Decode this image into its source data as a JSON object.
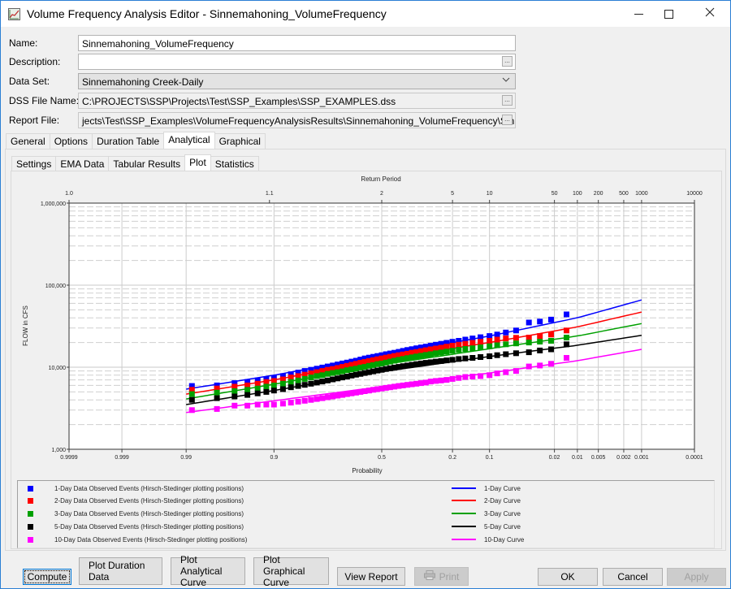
{
  "window": {
    "title": "Volume Frequency Analysis Editor - Sinnemahoning_VolumeFrequency",
    "minimize_icon": "minimize-icon",
    "maximize_icon": "maximize-icon",
    "close_icon": "close-icon"
  },
  "form": {
    "name_label": "Name:",
    "name_value": "Sinnemahoning_VolumeFrequency",
    "description_label": "Description:",
    "description_value": "",
    "dataset_label": "Data Set:",
    "dataset_value": "Sinnemahoning Creek-Daily",
    "dss_label": "DSS File Name:",
    "dss_value": "C:\\PROJECTS\\SSP\\Projects\\Test\\SSP_Examples\\SSP_EXAMPLES.dss",
    "report_label": "Report File:",
    "report_value": "jects\\Test\\SSP_Examples\\VolumeFrequencyAnalysisResults\\Sinnemahoning_VolumeFrequency\\Sinnemaho",
    "browse_label": "..."
  },
  "main_tabs": [
    {
      "label": "General",
      "active": false
    },
    {
      "label": "Options",
      "active": false
    },
    {
      "label": "Duration Table",
      "active": false
    },
    {
      "label": "Analytical",
      "active": true
    },
    {
      "label": "Graphical",
      "active": false
    }
  ],
  "sub_tabs": [
    {
      "label": "Settings",
      "active": false
    },
    {
      "label": "EMA Data",
      "active": false
    },
    {
      "label": "Tabular Results",
      "active": false
    },
    {
      "label": "Plot",
      "active": true
    },
    {
      "label": "Statistics",
      "active": false
    }
  ],
  "chart_data": {
    "type": "scatter",
    "title": "",
    "xlabel": "Probability",
    "ylabel": "FLOW in CFS",
    "x2label": "Return Period",
    "x_scale": "normal-probability",
    "y_scale": "log",
    "ylim": [
      1000,
      1000000
    ],
    "xlim": [
      0.9999,
      0.0001
    ],
    "grid": true,
    "x_ticks": [
      "0.9999",
      "0.999",
      "0.99",
      "0.9",
      "0.5",
      "0.2",
      "0.1",
      "0.02",
      "0.01",
      "0.005",
      "0.002",
      "0.001",
      "0.0001"
    ],
    "x_tick_values": [
      0.9999,
      0.999,
      0.99,
      0.9,
      0.5,
      0.2,
      0.1,
      0.02,
      0.01,
      0.005,
      0.002,
      0.001,
      0.0001
    ],
    "x2_ticks": [
      "1.0",
      "1.1",
      "2",
      "5",
      "10",
      "50",
      "100",
      "200",
      "500",
      "1000",
      "10000"
    ],
    "x2_tick_probs": [
      0.9999,
      0.9091,
      0.5,
      0.2,
      0.1,
      0.02,
      0.01,
      0.005,
      0.002,
      0.001,
      0.0001
    ],
    "y_ticks": [
      "1,000",
      "10,000",
      "100,000",
      "1,000,000"
    ],
    "y_tick_values": [
      1000,
      10000,
      100000,
      1000000
    ],
    "legend_position": "bottom",
    "series": [
      {
        "name": "1-Day Data Observed Events (Hirsch-Stedinger plotting positions)",
        "kind": "points",
        "color": "#0000ff",
        "x": [
          0.988,
          0.975,
          0.96,
          0.945,
          0.93,
          0.915,
          0.9,
          0.88,
          0.86,
          0.84,
          0.82,
          0.8,
          0.78,
          0.76,
          0.74,
          0.72,
          0.7,
          0.68,
          0.66,
          0.64,
          0.62,
          0.6,
          0.58,
          0.56,
          0.54,
          0.52,
          0.5,
          0.48,
          0.46,
          0.44,
          0.42,
          0.4,
          0.38,
          0.36,
          0.34,
          0.32,
          0.3,
          0.28,
          0.26,
          0.24,
          0.22,
          0.2,
          0.18,
          0.16,
          0.14,
          0.12,
          0.1,
          0.085,
          0.07,
          0.055,
          0.04,
          0.03,
          0.022,
          0.014
        ],
        "y": [
          5900,
          6000,
          6400,
          6600,
          6900,
          7100,
          7400,
          7800,
          8200,
          8600,
          9000,
          9300,
          9600,
          9900,
          10200,
          10500,
          10800,
          11100,
          11400,
          11700,
          12000,
          12400,
          12800,
          13100,
          13400,
          13700,
          14000,
          14400,
          14700,
          15000,
          15400,
          15800,
          16200,
          16600,
          17000,
          17400,
          17800,
          18300,
          18800,
          19300,
          19800,
          20400,
          21000,
          21700,
          22400,
          23200,
          24000,
          25000,
          26500,
          28000,
          35000,
          36000,
          38000,
          44000
        ]
      },
      {
        "name": "2-Day Data Observed Events (Hirsch-Stedinger plotting positions)",
        "kind": "points",
        "color": "#ff0000",
        "x": [
          0.988,
          0.975,
          0.96,
          0.945,
          0.93,
          0.915,
          0.9,
          0.88,
          0.86,
          0.84,
          0.82,
          0.8,
          0.78,
          0.76,
          0.74,
          0.72,
          0.7,
          0.68,
          0.66,
          0.64,
          0.62,
          0.6,
          0.58,
          0.56,
          0.54,
          0.52,
          0.5,
          0.48,
          0.46,
          0.44,
          0.42,
          0.4,
          0.38,
          0.36,
          0.34,
          0.32,
          0.3,
          0.28,
          0.26,
          0.24,
          0.22,
          0.2,
          0.18,
          0.16,
          0.14,
          0.12,
          0.1,
          0.085,
          0.07,
          0.055,
          0.04,
          0.03,
          0.022,
          0.014
        ],
        "y": [
          5300,
          5500,
          5800,
          6000,
          6300,
          6600,
          6800,
          7100,
          7500,
          7800,
          8100,
          8400,
          8700,
          9000,
          9300,
          9500,
          9800,
          10100,
          10400,
          10700,
          11000,
          11300,
          11600,
          11900,
          12200,
          12500,
          12800,
          13100,
          13400,
          13700,
          14000,
          14300,
          14600,
          15000,
          15300,
          15700,
          16100,
          16500,
          16900,
          17300,
          17800,
          18300,
          18800,
          19300,
          19800,
          20400,
          21000,
          21700,
          22400,
          22800,
          23000,
          24000,
          25000,
          28000
        ]
      },
      {
        "name": "3-Day Data Observed Events (Hirsch-Stedinger plotting positions)",
        "kind": "points",
        "color": "#00a000",
        "x": [
          0.988,
          0.975,
          0.96,
          0.945,
          0.93,
          0.915,
          0.9,
          0.88,
          0.86,
          0.84,
          0.82,
          0.8,
          0.78,
          0.76,
          0.74,
          0.72,
          0.7,
          0.68,
          0.66,
          0.64,
          0.62,
          0.6,
          0.58,
          0.56,
          0.54,
          0.52,
          0.5,
          0.48,
          0.46,
          0.44,
          0.42,
          0.4,
          0.38,
          0.36,
          0.34,
          0.32,
          0.3,
          0.28,
          0.26,
          0.24,
          0.22,
          0.2,
          0.18,
          0.16,
          0.14,
          0.12,
          0.1,
          0.085,
          0.07,
          0.055,
          0.04,
          0.03,
          0.022,
          0.014
        ],
        "y": [
          4700,
          4900,
          5100,
          5300,
          5500,
          5800,
          6000,
          6300,
          6600,
          6900,
          7200,
          7500,
          7800,
          8000,
          8300,
          8500,
          8700,
          8900,
          9200,
          9400,
          9600,
          9900,
          10100,
          10400,
          10600,
          10900,
          11100,
          11400,
          11700,
          12000,
          12300,
          12600,
          12900,
          13200,
          13500,
          13800,
          14100,
          14400,
          14800,
          15100,
          15500,
          15900,
          16300,
          16700,
          17000,
          17500,
          18000,
          18500,
          19000,
          19500,
          20000,
          20500,
          21000,
          23000
        ]
      },
      {
        "name": "5-Day Data Observed Events (Hirsch-Stedinger plotting positions)",
        "kind": "points",
        "color": "#000000",
        "x": [
          0.988,
          0.975,
          0.96,
          0.945,
          0.93,
          0.915,
          0.9,
          0.88,
          0.86,
          0.84,
          0.82,
          0.8,
          0.78,
          0.76,
          0.74,
          0.72,
          0.7,
          0.68,
          0.66,
          0.64,
          0.62,
          0.6,
          0.58,
          0.56,
          0.54,
          0.52,
          0.5,
          0.48,
          0.46,
          0.44,
          0.42,
          0.4,
          0.38,
          0.36,
          0.34,
          0.32,
          0.3,
          0.28,
          0.26,
          0.24,
          0.22,
          0.2,
          0.18,
          0.16,
          0.14,
          0.12,
          0.1,
          0.085,
          0.07,
          0.055,
          0.04,
          0.03,
          0.022,
          0.014
        ],
        "y": [
          4000,
          4200,
          4400,
          4600,
          4800,
          5000,
          5200,
          5400,
          5700,
          5900,
          6100,
          6300,
          6500,
          6700,
          6900,
          7100,
          7300,
          7500,
          7700,
          7900,
          8100,
          8300,
          8500,
          8700,
          8900,
          9100,
          9300,
          9500,
          9700,
          9900,
          10100,
          10300,
          10500,
          10700,
          10900,
          11100,
          11300,
          11500,
          11700,
          11900,
          12100,
          12300,
          12600,
          12800,
          13000,
          13300,
          13600,
          14000,
          14400,
          14800,
          15200,
          16000,
          16500,
          19000
        ]
      },
      {
        "name": "10-Day Data Observed Events (Hirsch-Stedinger plotting positions)",
        "kind": "points",
        "color": "#ff00ff",
        "x": [
          0.988,
          0.975,
          0.96,
          0.945,
          0.93,
          0.915,
          0.9,
          0.88,
          0.86,
          0.84,
          0.82,
          0.8,
          0.78,
          0.76,
          0.74,
          0.72,
          0.7,
          0.68,
          0.66,
          0.64,
          0.62,
          0.6,
          0.58,
          0.56,
          0.54,
          0.52,
          0.5,
          0.48,
          0.46,
          0.44,
          0.42,
          0.4,
          0.38,
          0.36,
          0.34,
          0.32,
          0.3,
          0.28,
          0.26,
          0.24,
          0.22,
          0.2,
          0.18,
          0.16,
          0.14,
          0.12,
          0.1,
          0.085,
          0.07,
          0.055,
          0.04,
          0.03,
          0.022,
          0.014
        ],
        "y": [
          3000,
          3100,
          3400,
          3400,
          3500,
          3500,
          3500,
          3600,
          3700,
          3800,
          3900,
          4000,
          4100,
          4200,
          4300,
          4400,
          4500,
          4600,
          4700,
          4800,
          4900,
          5000,
          5100,
          5200,
          5300,
          5400,
          5500,
          5600,
          5700,
          5800,
          5900,
          6000,
          6100,
          6200,
          6300,
          6400,
          6500,
          6700,
          6800,
          6900,
          7000,
          7200,
          7400,
          7600,
          7700,
          7800,
          8000,
          8400,
          8700,
          9000,
          10200,
          10500,
          11000,
          13000
        ]
      },
      {
        "name": "1-Day Curve",
        "kind": "line",
        "color": "#0000ff",
        "x": [
          0.99,
          0.9,
          0.5,
          0.1,
          0.01,
          0.001
        ],
        "y": [
          5400,
          8000,
          14000,
          24000,
          40000,
          66000
        ]
      },
      {
        "name": "2-Day Curve",
        "kind": "line",
        "color": "#ff0000",
        "x": [
          0.99,
          0.9,
          0.5,
          0.1,
          0.01,
          0.001
        ],
        "y": [
          4700,
          7000,
          12300,
          20000,
          31000,
          47000
        ]
      },
      {
        "name": "3-Day Curve",
        "kind": "line",
        "color": "#00a000",
        "x": [
          0.99,
          0.9,
          0.5,
          0.1,
          0.01,
          0.001
        ],
        "y": [
          4100,
          6200,
          10700,
          16800,
          24000,
          34000
        ]
      },
      {
        "name": "5-Day Curve",
        "kind": "line",
        "color": "#000000",
        "x": [
          0.99,
          0.9,
          0.5,
          0.1,
          0.01,
          0.001
        ],
        "y": [
          3500,
          5200,
          8800,
          13500,
          18500,
          24500
        ]
      },
      {
        "name": "10-Day Curve",
        "kind": "line",
        "color": "#ff00ff",
        "x": [
          0.99,
          0.9,
          0.5,
          0.1,
          0.01,
          0.001
        ],
        "y": [
          2800,
          3900,
          5800,
          8500,
          12000,
          16500
        ]
      }
    ]
  },
  "legend": {
    "points": [
      {
        "label": "1-Day Data Observed Events (Hirsch-Stedinger plotting positions)",
        "color": "#0000ff"
      },
      {
        "label": "2-Day Data Observed Events (Hirsch-Stedinger plotting positions)",
        "color": "#ff0000"
      },
      {
        "label": "3-Day Data Observed Events (Hirsch-Stedinger plotting positions)",
        "color": "#00a000"
      },
      {
        "label": "5-Day Data Observed Events (Hirsch-Stedinger plotting positions)",
        "color": "#000000"
      },
      {
        "label": "10-Day Data Observed Events (Hirsch-Stedinger plotting positions)",
        "color": "#ff00ff"
      }
    ],
    "lines": [
      {
        "label": "1-Day Curve",
        "color": "#0000ff"
      },
      {
        "label": "2-Day Curve",
        "color": "#ff0000"
      },
      {
        "label": "3-Day Curve",
        "color": "#00a000"
      },
      {
        "label": "5-Day Curve",
        "color": "#000000"
      },
      {
        "label": "10-Day Curve",
        "color": "#ff00ff"
      }
    ]
  },
  "buttons": {
    "compute": "Compute",
    "plot_duration_1": "Plot Duration",
    "plot_duration_2": "Data",
    "plot_analytical_1": "Plot Analytical",
    "plot_analytical_2": "Curve",
    "plot_graphical_1": "Plot Graphical",
    "plot_graphical_2": "Curve",
    "view_report": "View Report",
    "print": "Print",
    "ok": "OK",
    "cancel": "Cancel",
    "apply": "Apply"
  }
}
